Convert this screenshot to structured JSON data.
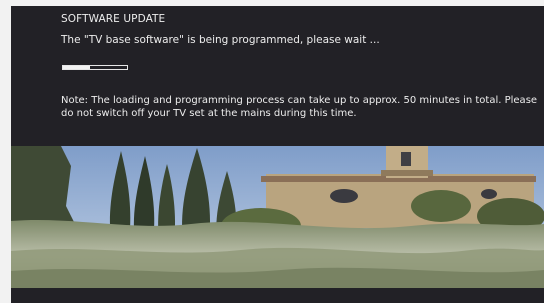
{
  "dialog": {
    "title": "SOFTWARE UPDATE",
    "status": "The \"TV base software\" is being programmed, please wait ...",
    "progress_fraction": 0.42,
    "note": "Note: The loading and programming process can take up to approx. 50 minutes in total. Please do not switch off your TV set at the mains during this time."
  },
  "colors": {
    "panel_background": "#222126",
    "text": "#ededed",
    "page_background": "#f2f2f2"
  }
}
